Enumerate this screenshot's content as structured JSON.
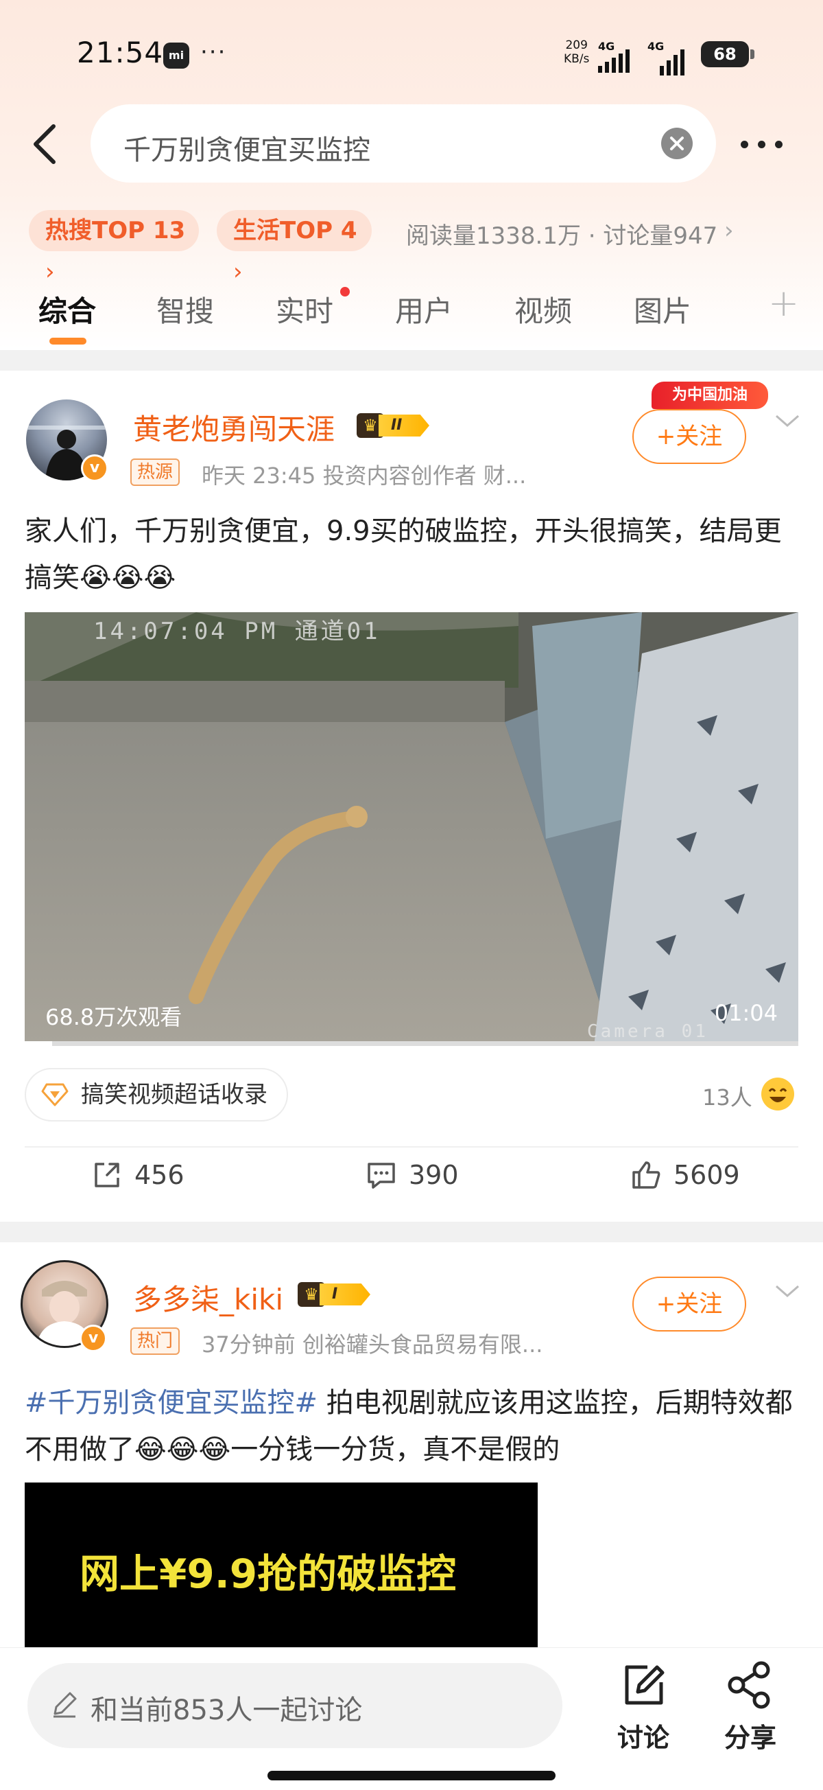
{
  "status_bar": {
    "time": "21:54",
    "speed_value": "209",
    "speed_unit": "KB/s",
    "net1": "4G",
    "net2": "4G",
    "battery": "68"
  },
  "search": {
    "query": "千万别贪便宜买监控"
  },
  "chips": [
    {
      "label": "热搜TOP 13"
    },
    {
      "label": "生活TOP 4"
    }
  ],
  "stats": {
    "text": "阅读量1338.1万 · 讨论量947"
  },
  "tabs": [
    {
      "label": "综合",
      "active": true
    },
    {
      "label": "智搜"
    },
    {
      "label": "实时"
    },
    {
      "label": "用户"
    },
    {
      "label": "视频"
    },
    {
      "label": "图片"
    }
  ],
  "post1": {
    "username": "黄老炮勇闯天涯",
    "level": "II",
    "tag": "热源",
    "meta": "昨天 23:45  投资内容创作者 财...",
    "follow_badge": "为中国加油",
    "follow_label": "+关注",
    "text": "家人们，千万别贪便宜，9.9买的破监控，开头很搞笑，结局更搞笑😭😭😭",
    "video": {
      "views": "68.8万次观看",
      "duration": "01:04",
      "osd_text": "14:07:04 PM 通道01",
      "osd_text2": "Camera 01"
    },
    "supertopic": "搞笑视频超话收录",
    "people": "13人",
    "reposts": "456",
    "comments": "390",
    "likes": "5609"
  },
  "post2": {
    "username": "多多柒_kiki",
    "level": "I",
    "tag": "热门",
    "meta": "37分钟前  创裕罐头食品贸易有限...",
    "follow_label": "+关注",
    "hashtag": "#千万别贪便宜买监控#",
    "text": " 拍电视剧就应该用这监控，后期特效都不用做了😂😂😂一分钱一分货，真不是假的",
    "image_text": "网上¥9.9抢的破监控"
  },
  "bottom_bar": {
    "input_placeholder": "和当前853人一起讨论",
    "discuss_label": "讨论",
    "share_label": "分享"
  },
  "colors": {
    "accent": "#ff8a2a",
    "username": "#f06016",
    "hashtag": "#4a6fb0",
    "chip_bg": "#fde2d6"
  }
}
